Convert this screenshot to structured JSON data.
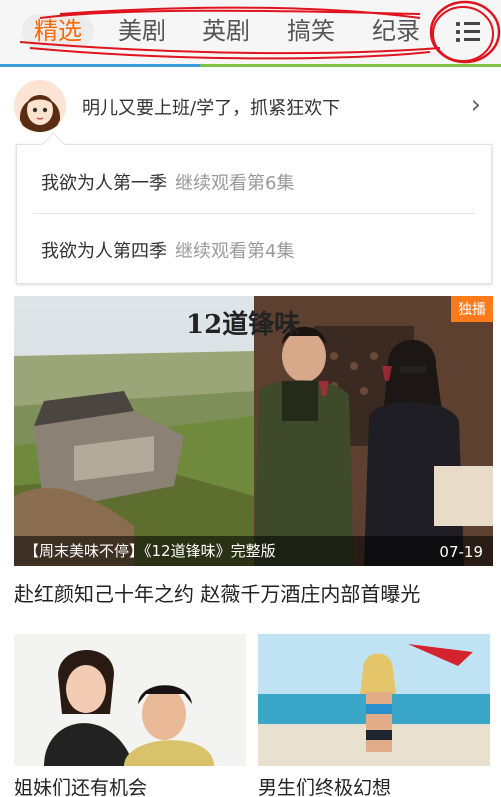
{
  "tabs": [
    {
      "label": "精选",
      "active": true
    },
    {
      "label": "美剧",
      "active": false
    },
    {
      "label": "英剧",
      "active": false
    },
    {
      "label": "搞笑",
      "active": false
    },
    {
      "label": "纪录",
      "active": false
    }
  ],
  "menu_icon": "list-menu-icon",
  "history": {
    "title": "明儿又要上班/学了，抓紧狂欢下",
    "chevron": "›"
  },
  "continue_watching": [
    {
      "show": "我欲为人第一季",
      "progress": "继续观看第6集"
    },
    {
      "show": "我欲为人第四季",
      "progress": "继续观看第4集"
    }
  ],
  "featured": {
    "badge": "独播",
    "logo_text": "12道锋味",
    "caption": "【周末美味不停】《12道锋味》完整版",
    "date": "07-19",
    "title": "赴红颜知己十年之约 赵薇千万酒庄内部首曝光"
  },
  "cards": [
    {
      "title": "姐妹们还有机会"
    },
    {
      "title": "男生们终极幻想"
    }
  ],
  "colors": {
    "accent": "#ff6a00",
    "badge": "#ff7a1a",
    "annotation": "#e0141e"
  }
}
